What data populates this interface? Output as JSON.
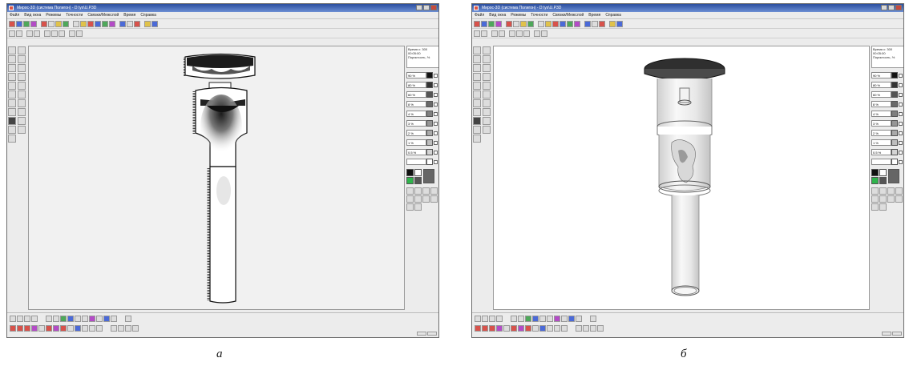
{
  "windows": [
    {
      "id": "a",
      "title": "Мирос-3D (система Полигон) - D:\\ys\\U.P3D",
      "menu": [
        "Файл",
        "Вид окна",
        "Режимы",
        "Точности",
        "Связки/Межслой",
        "Время",
        "Справка"
      ],
      "info_lines": [
        "Время с: 300",
        "00:05:00",
        "Пористость, %"
      ],
      "legend": [
        {
          "label": "90 %",
          "color": "#111111"
        },
        {
          "label": "80 %",
          "color": "#333333"
        },
        {
          "label": "60 %",
          "color": "#555555"
        },
        {
          "label": "8 %",
          "color": "#6a6a6a"
        },
        {
          "label": "4 %",
          "color": "#808080"
        },
        {
          "label": "3 %",
          "color": "#969696"
        },
        {
          "label": "2 %",
          "color": "#aaaaaa"
        },
        {
          "label": "1 %",
          "color": "#bebebe"
        },
        {
          "label": "0.5 %",
          "color": "#d4d4d4"
        },
        {
          "label": "",
          "color": "#ffffff"
        }
      ],
      "palette": [
        "#111111",
        "#ffffff",
        "#2fb44c",
        "#555555",
        "#999999",
        "#d0d0d0"
      ],
      "caption": "а",
      "icons": {
        "app": "app-icon",
        "minimize": "minimize-icon",
        "maximize": "maximize-icon",
        "close": "close-icon",
        "save": "save-icon"
      }
    },
    {
      "id": "b",
      "title": "Мирос-3D (система Полигон) - D:\\ys\\U.P3D",
      "menu": [
        "Файл",
        "Вид окна",
        "Режимы",
        "Точности",
        "Связки/Межслой",
        "Время",
        "Справка"
      ],
      "info_lines": [
        "Время с: 300",
        "00:05:00",
        "Пористость, %"
      ],
      "legend": [
        {
          "label": "90 %",
          "color": "#111111"
        },
        {
          "label": "80 %",
          "color": "#333333"
        },
        {
          "label": "60 %",
          "color": "#555555"
        },
        {
          "label": "8 %",
          "color": "#6a6a6a"
        },
        {
          "label": "4 %",
          "color": "#808080"
        },
        {
          "label": "3 %",
          "color": "#969696"
        },
        {
          "label": "2 %",
          "color": "#aaaaaa"
        },
        {
          "label": "1 %",
          "color": "#bebebe"
        },
        {
          "label": "0.5 %",
          "color": "#d4d4d4"
        },
        {
          "label": "",
          "color": "#ffffff"
        }
      ],
      "palette": [
        "#111111",
        "#ffffff",
        "#2fb44c",
        "#555555",
        "#999999",
        "#d0d0d0"
      ],
      "caption": "б",
      "icons": {
        "app": "app-icon",
        "minimize": "minimize-icon",
        "maximize": "maximize-icon",
        "close": "close-icon",
        "save": "save-icon"
      }
    }
  ]
}
